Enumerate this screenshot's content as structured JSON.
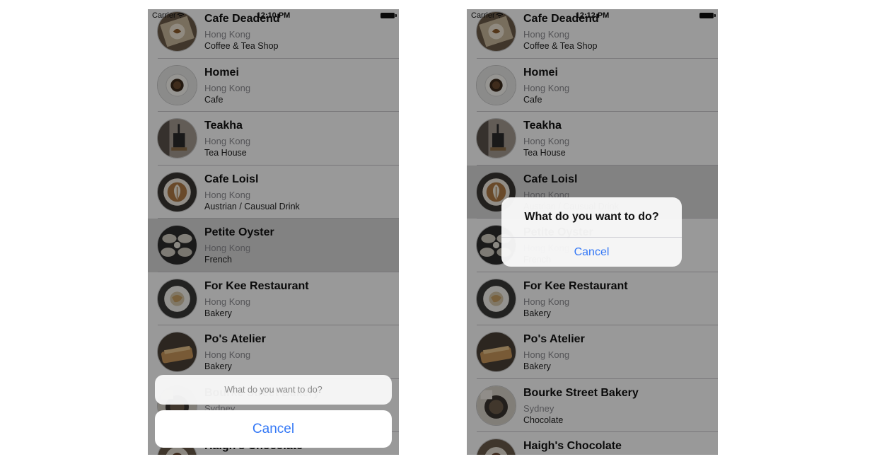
{
  "status_bar": {
    "left": {
      "carrier": "Carrier",
      "time": "12:10 PM"
    },
    "right": {
      "carrier": "Carrier",
      "time": "12:12 PM"
    }
  },
  "restaurants": [
    {
      "name": "Cafe Deadend",
      "location": "Hong Kong",
      "type": "Coffee & Tea Shop"
    },
    {
      "name": "Homei",
      "location": "Hong Kong",
      "type": "Cafe"
    },
    {
      "name": "Teakha",
      "location": "Hong Kong",
      "type": "Tea House"
    },
    {
      "name": "Cafe Loisl",
      "location": "Hong Kong",
      "type": "Austrian / Causual Drink"
    },
    {
      "name": "Petite Oyster",
      "location": "Hong Kong",
      "type": "French"
    },
    {
      "name": "For Kee Restaurant",
      "location": "Hong Kong",
      "type": "Bakery"
    },
    {
      "name": "Po's Atelier",
      "location": "Hong Kong",
      "type": "Bakery"
    },
    {
      "name": "Bourke Street Bakery",
      "location": "Sydney",
      "type": "Chocolate"
    },
    {
      "name": "Haigh's Chocolate",
      "location": "",
      "type": ""
    }
  ],
  "left_screen": {
    "selected_index": 4,
    "action_sheet": {
      "title": "What do you want to do?",
      "cancel_label": "Cancel"
    }
  },
  "right_screen": {
    "selected_index": 3,
    "alert": {
      "title": "What do you want to do?",
      "cancel_label": "Cancel"
    }
  },
  "colors": {
    "tint": "#3478f6",
    "selected_row": "#d9d9d9",
    "dim_overlay": "rgba(0,0,0,0.40)"
  },
  "icons": [
    "wifi-icon",
    "battery-icon"
  ]
}
